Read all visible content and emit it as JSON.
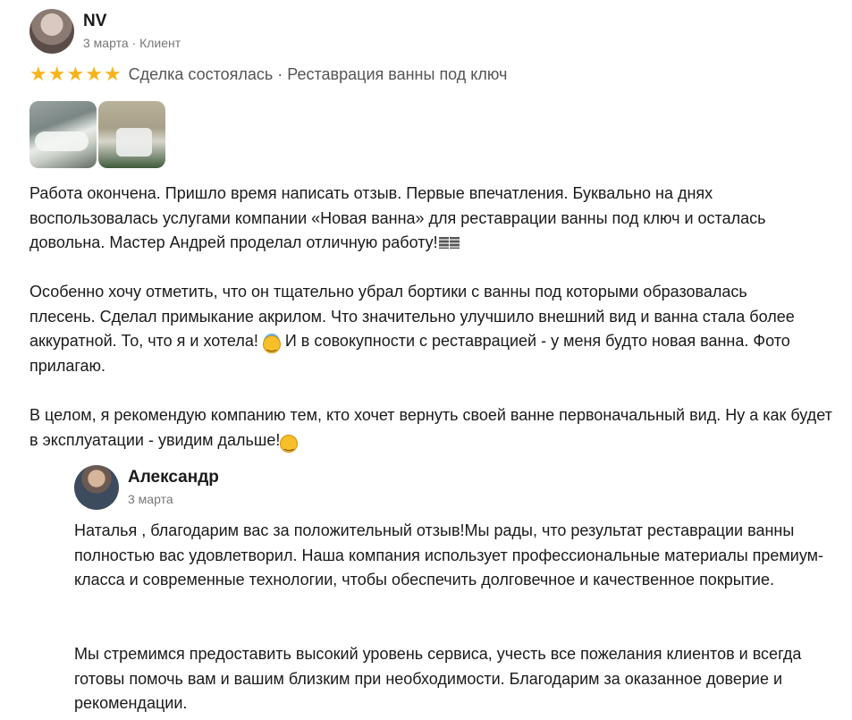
{
  "review": {
    "author": {
      "name": "NV",
      "date": "3 марта",
      "separator": " · ",
      "role": "Клиент"
    },
    "rating": 5,
    "stars": [
      "★",
      "★",
      "★",
      "★",
      "★"
    ],
    "deal_text": "Сделка состоялась · Реставрация ванны под ключ",
    "photos_count": 2,
    "paragraph_1": "Работа окончена. Пришло время написать отзыв. Первые впечатления. Буквально на днях воспользовалась услугами компании «Новая ванна» для реставрации ванны под ключ и осталась довольна. Мастер Андрей проделал отличную работу!",
    "paragraph_2_before_emoji": "Особенно хочу отметить, что он тщательно убрал бортики с ванны под которыми образовалась плесень. Сделал примыкание акрилом. Что значительно улучшило внешний вид и ванна стала более аккуратной. То, что я и хотела! ",
    "paragraph_2_after_emoji": " И в совокупности с реставрацией - у меня будто новая ванна. Фото прилагаю.",
    "paragraph_3": "В целом, я рекомендую компанию тем, кто хочет вернуть своей ванне первоначальный вид. Ну а как будет в эксплуатации - увидим дальше!",
    "emoji_smile": "smiling-face-with-halo-icon",
    "emoji_blush": "smiling-face-icon",
    "colors": {
      "star": "#f6b41b",
      "muted_text": "#777777",
      "body_text": "#1a1a1a"
    }
  },
  "reply": {
    "author": {
      "name": "Александр",
      "date": "3 марта"
    },
    "paragraph_1": "Наталья , благодарим вас за положительный отзыв!Мы рады, что результат реставрации ванны полностью вас удовлетворил. Наша компания использует профессиональные материалы премиум-класса и современные технологии, чтобы обеспечить долговечное и качественное покрытие.",
    "paragraph_2": "Мы стремимся предоставить высокий уровень сервиса, учесть все пожелания клиентов и всегда готовы помочь вам и вашим близким при необходимости. Благодарим за оказанное доверие и рекомендации."
  }
}
